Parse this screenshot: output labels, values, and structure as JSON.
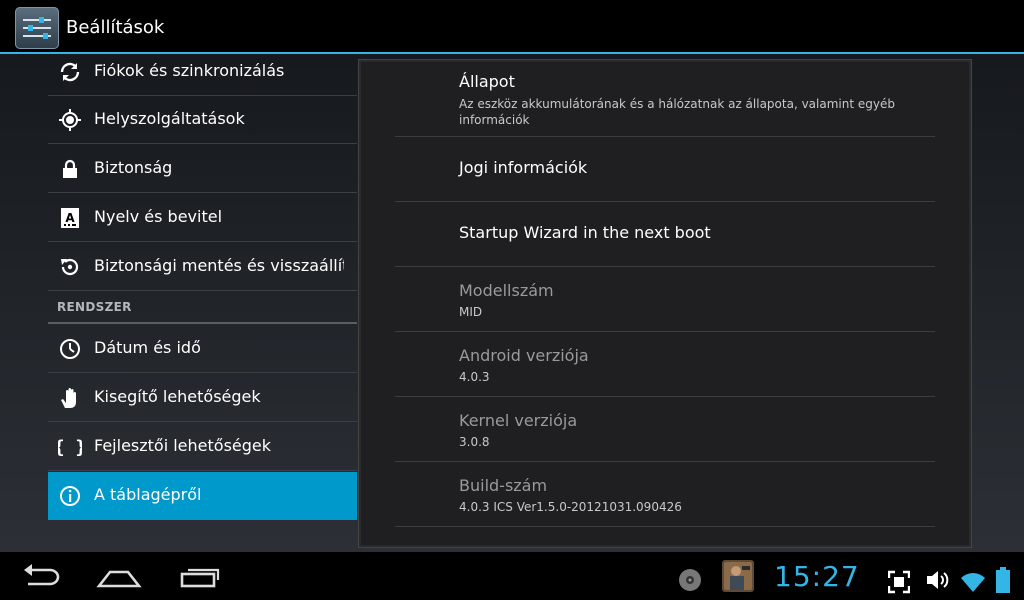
{
  "actionbar": {
    "title": "Beállítások",
    "app_icon": "settings-sliders-icon"
  },
  "left_list": {
    "items_top": [
      {
        "label": "Fiókok és szinkronizálás",
        "icon": "sync-icon"
      },
      {
        "label": "Helyszolgáltatások",
        "icon": "location-icon"
      },
      {
        "label": "Biztonság",
        "icon": "lock-icon"
      },
      {
        "label": "Nyelv és bevitel",
        "icon": "keyboard-a-icon"
      },
      {
        "label": "Biztonsági mentés és visszaállítás",
        "icon": "backup-restore-icon"
      }
    ],
    "section_header": "RENDSZER",
    "items_system": [
      {
        "label": "Dátum és idő",
        "icon": "clock-icon"
      },
      {
        "label": "Kisegítő lehetőségek",
        "icon": "hand-icon"
      },
      {
        "label": "Fejlesztői lehetőségek",
        "icon": "braces-icon"
      },
      {
        "label": "A táblagépről",
        "icon": "info-icon",
        "selected": true
      }
    ]
  },
  "right_panel": {
    "items": [
      {
        "title": "Állapot",
        "summary_line1": "Az eszköz akkumulátorának és a hálózatnak az állapota, valamint egyéb",
        "summary_line2": "információk"
      },
      {
        "title": "Jogi információk"
      },
      {
        "title": "Startup Wizard in the next boot"
      },
      {
        "title": "Modellszám",
        "summary": "MID"
      },
      {
        "title": "Android verziója",
        "summary": "4.0.3"
      },
      {
        "title": "Kernel verziója",
        "summary": "3.0.8"
      },
      {
        "title": "Build-szám",
        "summary": "4.0.3 ICS Ver1.5.0-20121031.090426"
      }
    ]
  },
  "navbar": {
    "clock": "15:27",
    "buttons": [
      "back-icon",
      "home-icon",
      "recent-apps-icon"
    ],
    "status_icons": [
      "disc-icon",
      "game-thumbnail-icon",
      "screenshot-icon",
      "volume-icon",
      "wifi-icon",
      "battery-icon"
    ]
  },
  "colors": {
    "accent": "#33b5e5",
    "selected": "#0099cc"
  }
}
